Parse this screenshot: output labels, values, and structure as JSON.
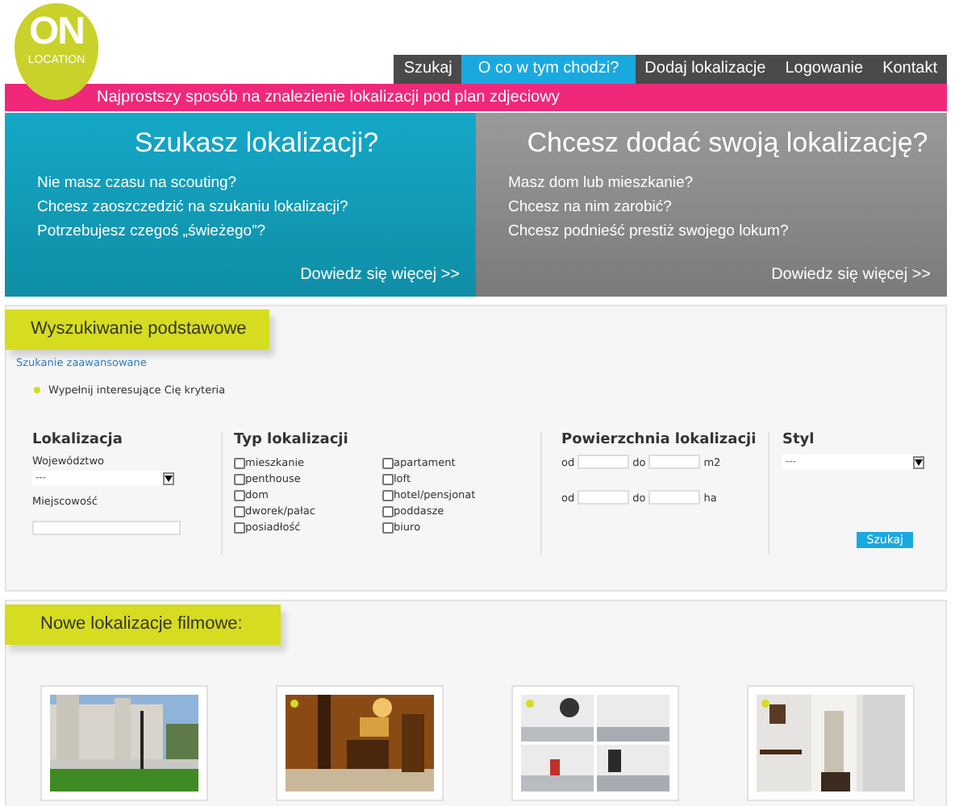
{
  "logo": {
    "big": "ON",
    "small": "LOCATION"
  },
  "nav": [
    {
      "label": "Szukaj",
      "selected": false
    },
    {
      "label": "O co w tym chodzi?",
      "selected": true
    },
    {
      "label": "Dodaj lokalizacje",
      "selected": false
    },
    {
      "label": "Logowanie",
      "selected": false
    },
    {
      "label": "Kontakt",
      "selected": false
    }
  ],
  "tagline": "Najprostszy sposób na znalezienie lokalizacji pod plan zdjeciowy",
  "hero": [
    {
      "kind": "search",
      "title": "Szukasz lokalizacji?",
      "lines": [
        "Nie masz czasu na scouting?",
        "Chcesz zaoszczedzić na szukaniu lokalizacji?",
        "Potrzebujesz czegoś „świeżego”?"
      ],
      "more": "Dowiedz się więcej >>"
    },
    {
      "kind": "add",
      "title": "Chcesz dodać swoją lokalizację?",
      "lines": [
        "Masz dom lub mieszkanie?",
        "Chcesz na nim zarobić?",
        "Chcesz podnieść prestiż swojego lokum?"
      ],
      "more": "Dowiedz się więcej >>"
    }
  ],
  "search": {
    "heading": "Wyszukiwanie podstawowe",
    "advanced_link": "Szukanie zaawansowane",
    "hint": "Wypełnij interesujące Cię kryteria",
    "location": {
      "heading": "Lokalizacja",
      "region_label": "Województwo",
      "region_value": "---",
      "city_label": "Miejscowość"
    },
    "types": {
      "heading": "Typ lokalizacji",
      "options": [
        {
          "label": "mieszkanie",
          "checked": false
        },
        {
          "label": "penthouse",
          "checked": false
        },
        {
          "label": "dom",
          "checked": false
        },
        {
          "label": "dworek/pałac",
          "checked": false
        },
        {
          "label": "posiadłość",
          "checked": false
        },
        {
          "label": "apartament",
          "checked": false
        },
        {
          "label": "loft",
          "checked": false
        },
        {
          "label": "hotel/pensjonat",
          "checked": false
        },
        {
          "label": "poddasze",
          "checked": false
        },
        {
          "label": "biuro",
          "checked": false
        }
      ]
    },
    "area": {
      "heading": "Powierzchnia lokalizacji",
      "rows": [
        {
          "from": "od",
          "to": "do",
          "unit": "m2"
        },
        {
          "from": "od",
          "to": "do",
          "unit": "ha"
        }
      ]
    },
    "style": {
      "heading": "Styl",
      "value": "---"
    },
    "button": "Szukaj"
  },
  "new_locations": {
    "heading": "Nowe lokalizacje filmowe:",
    "items": [
      {
        "kind": "picture",
        "new": false
      },
      {
        "kind": "picture",
        "new": true
      },
      {
        "kind": "picture",
        "new": true
      },
      {
        "kind": "picture",
        "new": true
      }
    ]
  }
}
